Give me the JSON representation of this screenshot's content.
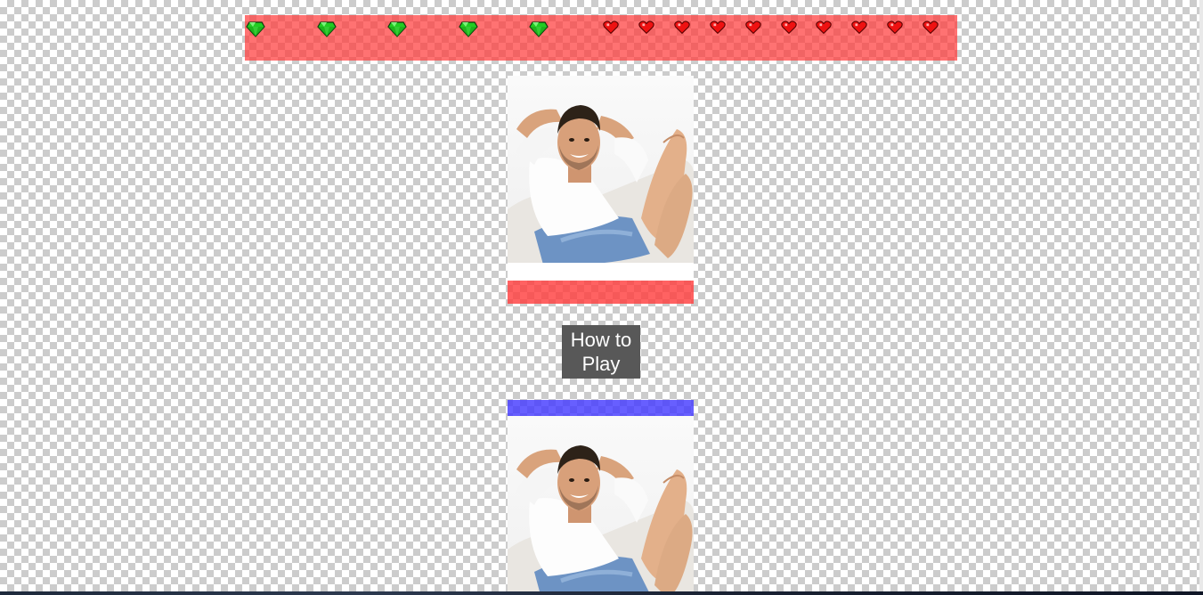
{
  "hud": {
    "gems": {
      "count": 5,
      "icon": "gem-icon",
      "color": "#22cc22"
    },
    "hearts": {
      "count": 10,
      "icon": "heart-icon",
      "color": "#ee1111"
    },
    "bar_color": "#ff3c3c"
  },
  "player_top": {
    "portrait": "man-relaxing-portrait",
    "health_bar_color": "#ff3c3c",
    "health": 1.0
  },
  "how_to_play": {
    "label": "How to Play"
  },
  "player_bottom": {
    "portrait": "man-relaxing-portrait",
    "health_bar_color": "#4a3cff",
    "health": 1.0
  }
}
